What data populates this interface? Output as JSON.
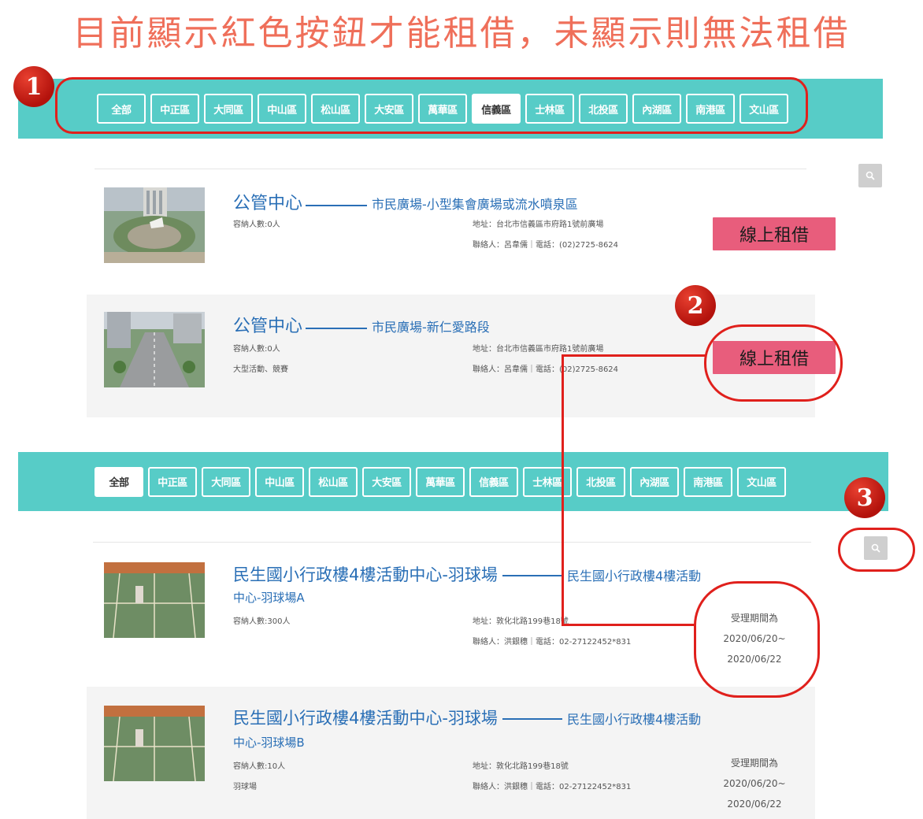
{
  "headline": "目前顯示紅色按鈕才能租借，未顯示則無法租借",
  "districts": [
    "全部",
    "中正區",
    "大同區",
    "中山區",
    "松山區",
    "大安區",
    "萬華區",
    "信義區",
    "士林區",
    "北投區",
    "內湖區",
    "南港區",
    "文山區"
  ],
  "tabbar_top": {
    "active": "信義區"
  },
  "tabbar_bottom": {
    "active": "全部"
  },
  "badges": [
    "1",
    "2",
    "3"
  ],
  "venues_top": [
    {
      "org": "公管中心",
      "subtitle": "市民廣場-小型集會廣場或流水噴泉區",
      "capacity": "容納人數:0人",
      "note": "",
      "address": "地址：台北市信義區市府路1號前廣場",
      "contact": "聯絡人：呂韋儒｜電話：(02)2725-8624",
      "button": "線上租借"
    },
    {
      "org": "公管中心",
      "subtitle": "市民廣場-新仁愛路段",
      "capacity": "容納人數:0人",
      "note": "大型活動、競賽",
      "address": "地址：台北市信義區市府路1號前廣場",
      "contact": "聯絡人：呂韋儒｜電話：(02)2725-8624",
      "button": "線上租借"
    }
  ],
  "venues_bottom": [
    {
      "title": "民生國小行政樓4樓活動中心-羽球場",
      "subtitle": "民生國小行政樓4樓活動",
      "subtitle_cont": "中心-羽球場A",
      "capacity": "容納人數:300人",
      "note": "",
      "address": "地址：敦化北路199巷18號",
      "contact": "聯絡人：洪銀穗｜電話：02-27122452*831",
      "period_label": "受理期間為",
      "period_start": "2020/06/20~",
      "period_end": "2020/06/22"
    },
    {
      "title": "民生國小行政樓4樓活動中心-羽球場",
      "subtitle": "民生國小行政樓4樓活動",
      "subtitle_cont": "中心-羽球場B",
      "capacity": "容納人數:10人",
      "note": "羽球場",
      "address": "地址：敦化北路199巷18號",
      "contact": "聯絡人：洪銀穗｜電話：02-27122452*831",
      "period_label": "受理期間為",
      "period_start": "2020/06/20~",
      "period_end": "2020/06/22"
    }
  ],
  "colors": {
    "teal": "#57ccc7",
    "rent_button": "#e85d7c",
    "link_blue": "#2a6fb6",
    "annotation_red": "#e0201c"
  }
}
